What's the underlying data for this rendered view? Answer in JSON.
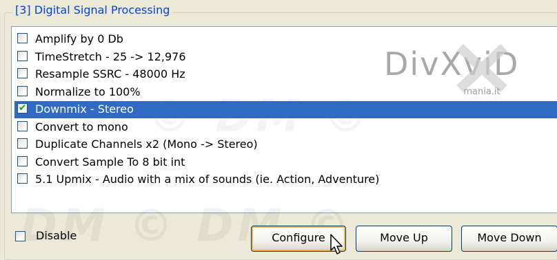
{
  "group": {
    "title": "[3] Digital Signal Processing"
  },
  "list": {
    "items": [
      {
        "label": "Amplify by 0 Db",
        "checked": false,
        "selected": false
      },
      {
        "label": "TimeStretch - 25 -> 12,976",
        "checked": false,
        "selected": false
      },
      {
        "label": "Resample SSRC - 48000 Hz",
        "checked": false,
        "selected": false
      },
      {
        "label": "Normalize to 100%",
        "checked": false,
        "selected": false
      },
      {
        "label": "Downmix - Stereo",
        "checked": true,
        "selected": true
      },
      {
        "label": "Convert to mono",
        "checked": false,
        "selected": false
      },
      {
        "label": "Duplicate Channels x2 (Mono -> Stereo)",
        "checked": false,
        "selected": false
      },
      {
        "label": "Convert Sample To 8 bit int",
        "checked": false,
        "selected": false
      },
      {
        "label": "5.1 Upmix - Audio with a mix of sounds (ie. Action, Adventure)",
        "checked": false,
        "selected": false
      }
    ]
  },
  "watermark": {
    "logo_text": "DivXviD",
    "logo_sub": "mania.it",
    "overlay": "DM © DM ©"
  },
  "footer": {
    "disable_label": "Disable",
    "disable_checked": false,
    "configure_label": "Configure",
    "move_up_label": "Move Up",
    "move_down_label": "Move Down"
  },
  "colors": {
    "selection": "#316ac5",
    "title": "#0046d5",
    "checkmark": "#21a121"
  }
}
